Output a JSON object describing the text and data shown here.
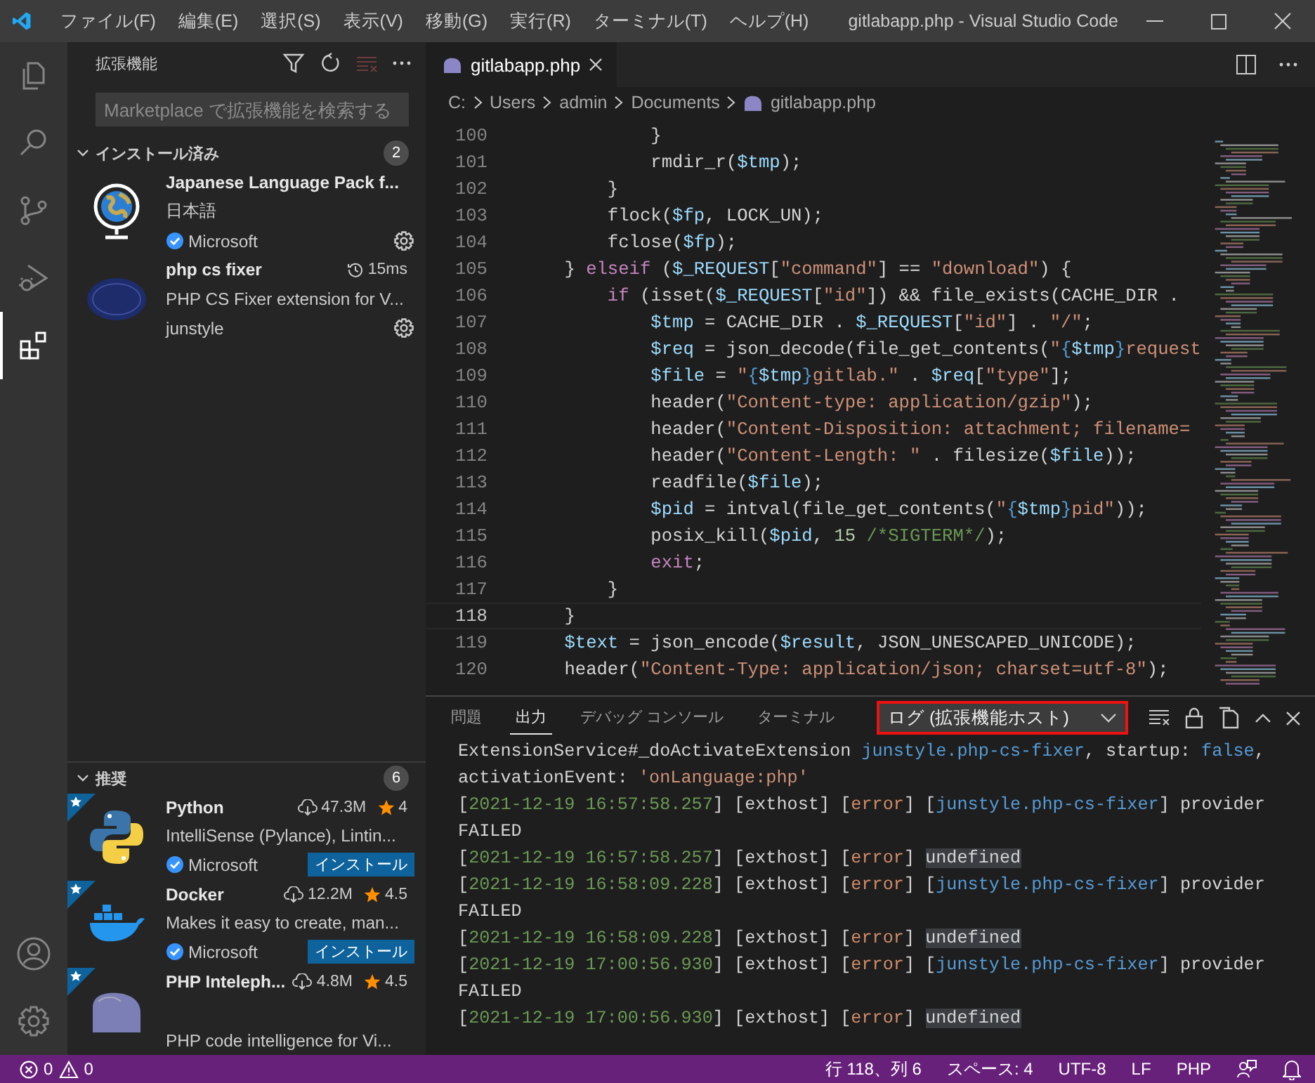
{
  "window": {
    "title": "gitlabapp.php - Visual Studio Code"
  },
  "menu": [
    "ファイル(F)",
    "編集(E)",
    "選択(S)",
    "表示(V)",
    "移動(G)",
    "実行(R)",
    "ターミナル(T)",
    "ヘルプ(H)"
  ],
  "activity_bar": {
    "items": [
      {
        "selected": false
      },
      {
        "selected": false
      },
      {
        "selected": false
      },
      {
        "selected": false
      },
      {
        "selected": true
      }
    ]
  },
  "sidebar": {
    "title": "拡張機能",
    "search": {
      "placeholder": "Marketplace で拡張機能を検索する"
    },
    "sections": [
      {
        "title": "インストール済み",
        "count": "2",
        "expanded": true,
        "items": [
          {
            "name": "Japanese Language Pack f...",
            "description": "日本語",
            "publisher": "Microsoft",
            "verified": true,
            "recommended": false
          },
          {
            "name": "php cs fixer",
            "activation_time": "15ms",
            "description": "PHP CS Fixer extension for V...",
            "publisher": "junstyle",
            "verified": false,
            "recommended": false
          }
        ]
      },
      {
        "title": "推奨",
        "count": "6",
        "expanded": true,
        "items": [
          {
            "name": "Python",
            "downloads": "47.3M",
            "rating": "4",
            "description": "IntelliSense (Pylance), Lintin...",
            "publisher": "Microsoft",
            "verified": true,
            "action": "インストール",
            "recommended": true
          },
          {
            "name": "Docker",
            "downloads": "12.2M",
            "rating": "4.5",
            "description": "Makes it easy to create, man...",
            "publisher": "Microsoft",
            "verified": true,
            "action": "インストール",
            "recommended": true
          },
          {
            "name": "PHP Inteleph...",
            "downloads": "4.8M",
            "rating": "4.5",
            "description": "PHP code intelligence for Vi...",
            "recommended": true
          }
        ]
      }
    ]
  },
  "editor": {
    "tab": {
      "label": "gitlabapp.php"
    },
    "breadcrumb": [
      "C:",
      "Users",
      "admin",
      "Documents",
      "gitlabapp.php"
    ],
    "lines": [
      {
        "number": "100",
        "current": false,
        "segments": [
          {
            "kind": "plain",
            "text": "            }"
          }
        ]
      },
      {
        "number": "101",
        "current": false,
        "segments": [
          {
            "kind": "plain",
            "text": "            rmdir_r("
          },
          {
            "kind": "var",
            "text": "$tmp"
          },
          {
            "kind": "plain",
            "text": ");"
          }
        ]
      },
      {
        "number": "102",
        "current": false,
        "segments": [
          {
            "kind": "plain",
            "text": "        }"
          }
        ]
      },
      {
        "number": "103",
        "current": false,
        "segments": [
          {
            "kind": "plain",
            "text": "        flock("
          },
          {
            "kind": "var",
            "text": "$fp"
          },
          {
            "kind": "plain",
            "text": ", LOCK_UN);"
          }
        ]
      },
      {
        "number": "104",
        "current": false,
        "segments": [
          {
            "kind": "plain",
            "text": "        fclose("
          },
          {
            "kind": "var",
            "text": "$fp"
          },
          {
            "kind": "plain",
            "text": ");"
          }
        ]
      },
      {
        "number": "105",
        "current": false,
        "segments": [
          {
            "kind": "plain",
            "text": "    } "
          },
          {
            "kind": "keyword",
            "text": "elseif"
          },
          {
            "kind": "plain",
            "text": " ("
          },
          {
            "kind": "var",
            "text": "$_REQUEST"
          },
          {
            "kind": "plain",
            "text": "["
          },
          {
            "kind": "string",
            "text": "\"command\""
          },
          {
            "kind": "plain",
            "text": "] == "
          },
          {
            "kind": "string",
            "text": "\"download\""
          },
          {
            "kind": "plain",
            "text": ") {"
          }
        ]
      },
      {
        "number": "106",
        "current": false,
        "segments": [
          {
            "kind": "keyword",
            "text": "        if"
          },
          {
            "kind": "plain",
            "text": " (isset("
          },
          {
            "kind": "var",
            "text": "$_REQUEST"
          },
          {
            "kind": "plain",
            "text": "["
          },
          {
            "kind": "string",
            "text": "\"id\""
          },
          {
            "kind": "plain",
            "text": "]) && file_exists(CACHE_DIR ."
          }
        ]
      },
      {
        "number": "107",
        "current": false,
        "segments": [
          {
            "kind": "var",
            "text": "            $tmp"
          },
          {
            "kind": "plain",
            "text": " = CACHE_DIR . "
          },
          {
            "kind": "var",
            "text": "$_REQUEST"
          },
          {
            "kind": "plain",
            "text": "["
          },
          {
            "kind": "string",
            "text": "\"id\""
          },
          {
            "kind": "plain",
            "text": "] . "
          },
          {
            "kind": "string",
            "text": "\"/\""
          },
          {
            "kind": "plain",
            "text": ";"
          }
        ]
      },
      {
        "number": "108",
        "current": false,
        "segments": [
          {
            "kind": "var",
            "text": "            $req"
          },
          {
            "kind": "plain",
            "text": " = json_decode(file_get_contents("
          },
          {
            "kind": "string",
            "text": "\""
          },
          {
            "kind": "interp",
            "text": "{"
          },
          {
            "kind": "var",
            "text": "$tmp"
          },
          {
            "kind": "interp",
            "text": "}"
          },
          {
            "kind": "string",
            "text": "request"
          }
        ]
      },
      {
        "number": "109",
        "current": false,
        "segments": [
          {
            "kind": "var",
            "text": "            $file"
          },
          {
            "kind": "plain",
            "text": " = "
          },
          {
            "kind": "string",
            "text": "\""
          },
          {
            "kind": "interp",
            "text": "{"
          },
          {
            "kind": "var",
            "text": "$tmp"
          },
          {
            "kind": "interp",
            "text": "}"
          },
          {
            "kind": "string",
            "text": "gitlab.\""
          },
          {
            "kind": "plain",
            "text": " . "
          },
          {
            "kind": "var",
            "text": "$req"
          },
          {
            "kind": "plain",
            "text": "["
          },
          {
            "kind": "string",
            "text": "\"type\""
          },
          {
            "kind": "plain",
            "text": "];"
          }
        ]
      },
      {
        "number": "110",
        "current": false,
        "segments": [
          {
            "kind": "plain",
            "text": "            header("
          },
          {
            "kind": "string",
            "text": "\"Content-type: application/gzip\""
          },
          {
            "kind": "plain",
            "text": ");"
          }
        ]
      },
      {
        "number": "111",
        "current": false,
        "segments": [
          {
            "kind": "plain",
            "text": "            header("
          },
          {
            "kind": "string",
            "text": "\"Content-Disposition: attachment; filename="
          }
        ]
      },
      {
        "number": "112",
        "current": false,
        "segments": [
          {
            "kind": "plain",
            "text": "            header("
          },
          {
            "kind": "string",
            "text": "\"Content-Length: \""
          },
          {
            "kind": "plain",
            "text": " . filesize("
          },
          {
            "kind": "var",
            "text": "$file"
          },
          {
            "kind": "plain",
            "text": "));"
          }
        ]
      },
      {
        "number": "113",
        "current": false,
        "segments": [
          {
            "kind": "plain",
            "text": "            readfile("
          },
          {
            "kind": "var",
            "text": "$file"
          },
          {
            "kind": "plain",
            "text": ");"
          }
        ]
      },
      {
        "number": "114",
        "current": false,
        "segments": [
          {
            "kind": "var",
            "text": "            $pid"
          },
          {
            "kind": "plain",
            "text": " = intval(file_get_contents("
          },
          {
            "kind": "string",
            "text": "\""
          },
          {
            "kind": "interp",
            "text": "{"
          },
          {
            "kind": "var",
            "text": "$tmp"
          },
          {
            "kind": "interp",
            "text": "}"
          },
          {
            "kind": "string",
            "text": "pid\""
          },
          {
            "kind": "plain",
            "text": "));"
          }
        ]
      },
      {
        "number": "115",
        "current": false,
        "segments": [
          {
            "kind": "plain",
            "text": "            posix_kill("
          },
          {
            "kind": "var",
            "text": "$pid"
          },
          {
            "kind": "plain",
            "text": ", "
          },
          {
            "kind": "number",
            "text": "15"
          },
          {
            "kind": "comment",
            "text": " /*SIGTERM*/"
          },
          {
            "kind": "plain",
            "text": ");"
          }
        ]
      },
      {
        "number": "116",
        "current": false,
        "segments": [
          {
            "kind": "keyword",
            "text": "            exit"
          },
          {
            "kind": "plain",
            "text": ";"
          }
        ]
      },
      {
        "number": "117",
        "current": false,
        "segments": [
          {
            "kind": "plain",
            "text": "        }"
          }
        ]
      },
      {
        "number": "118",
        "current": true,
        "segments": [
          {
            "kind": "plain",
            "text": "    }"
          }
        ]
      },
      {
        "number": "119",
        "current": false,
        "segments": [
          {
            "kind": "var",
            "text": "    $text"
          },
          {
            "kind": "plain",
            "text": " = json_encode("
          },
          {
            "kind": "var",
            "text": "$result"
          },
          {
            "kind": "plain",
            "text": ", JSON_UNESCAPED_UNICODE);"
          }
        ]
      },
      {
        "number": "120",
        "current": false,
        "segments": [
          {
            "kind": "plain",
            "text": "    header("
          },
          {
            "kind": "string",
            "text": "\"Content-Type: application/json; charset=utf-8\""
          },
          {
            "kind": "plain",
            "text": ");"
          }
        ]
      }
    ]
  },
  "panel": {
    "tabs": [
      {
        "label": "問題",
        "selected": false
      },
      {
        "label": "出力",
        "selected": true
      },
      {
        "label": "デバッグ コンソール",
        "selected": false
      },
      {
        "label": "ターミナル",
        "selected": false
      }
    ],
    "dropdown": {
      "value": "ログ (拡張機能ホスト)",
      "highlighted": true
    },
    "output": [
      [
        {
          "kind": "plain",
          "text": "ExtensionService#_doActivateExtension "
        },
        {
          "kind": "ext",
          "text": "junstyle.php-cs-fixer"
        },
        {
          "kind": "plain",
          "text": ", startup: "
        },
        {
          "kind": "bool",
          "text": "false"
        },
        {
          "kind": "plain",
          "text": ","
        }
      ],
      [
        {
          "kind": "plain",
          "text": "activationEvent: "
        },
        {
          "kind": "string",
          "text": "'onLanguage:php'"
        }
      ],
      [
        {
          "kind": "plain",
          "text": "["
        },
        {
          "kind": "date",
          "text": "2021-12-19 16:57:58.257"
        },
        {
          "kind": "plain",
          "text": "] [exthost] ["
        },
        {
          "kind": "error",
          "text": "error"
        },
        {
          "kind": "plain",
          "text": "] ["
        },
        {
          "kind": "ext",
          "text": "junstyle.php-cs-fixer"
        },
        {
          "kind": "plain",
          "text": "] provider"
        }
      ],
      [
        {
          "kind": "plain",
          "text": "FAILED"
        }
      ],
      [
        {
          "kind": "plain",
          "text": "["
        },
        {
          "kind": "date",
          "text": "2021-12-19 16:57:58.257"
        },
        {
          "kind": "plain",
          "text": "] [exthost] ["
        },
        {
          "kind": "error",
          "text": "error"
        },
        {
          "kind": "plain",
          "text": "] "
        },
        {
          "kind": "mark",
          "text": "undefined"
        }
      ],
      [
        {
          "kind": "plain",
          "text": "["
        },
        {
          "kind": "date",
          "text": "2021-12-19 16:58:09.228"
        },
        {
          "kind": "plain",
          "text": "] [exthost] ["
        },
        {
          "kind": "error",
          "text": "error"
        },
        {
          "kind": "plain",
          "text": "] ["
        },
        {
          "kind": "ext",
          "text": "junstyle.php-cs-fixer"
        },
        {
          "kind": "plain",
          "text": "] provider"
        }
      ],
      [
        {
          "kind": "plain",
          "text": "FAILED"
        }
      ],
      [
        {
          "kind": "plain",
          "text": "["
        },
        {
          "kind": "date",
          "text": "2021-12-19 16:58:09.228"
        },
        {
          "kind": "plain",
          "text": "] [exthost] ["
        },
        {
          "kind": "error",
          "text": "error"
        },
        {
          "kind": "plain",
          "text": "] "
        },
        {
          "kind": "mark",
          "text": "undefined"
        }
      ],
      [
        {
          "kind": "plain",
          "text": "["
        },
        {
          "kind": "date",
          "text": "2021-12-19 17:00:56.930"
        },
        {
          "kind": "plain",
          "text": "] [exthost] ["
        },
        {
          "kind": "error",
          "text": "error"
        },
        {
          "kind": "plain",
          "text": "] ["
        },
        {
          "kind": "ext",
          "text": "junstyle.php-cs-fixer"
        },
        {
          "kind": "plain",
          "text": "] provider"
        }
      ],
      [
        {
          "kind": "plain",
          "text": "FAILED"
        }
      ],
      [
        {
          "kind": "plain",
          "text": "["
        },
        {
          "kind": "date",
          "text": "2021-12-19 17:00:56.930"
        },
        {
          "kind": "plain",
          "text": "] [exthost] ["
        },
        {
          "kind": "error",
          "text": "error"
        },
        {
          "kind": "plain",
          "text": "] "
        },
        {
          "kind": "mark",
          "text": "undefined"
        }
      ]
    ]
  },
  "status_bar": {
    "errors": "0",
    "warnings": "0",
    "items": [
      "行 118、列 6",
      "スペース: 4",
      "UTF-8",
      "LF",
      "PHP"
    ]
  }
}
